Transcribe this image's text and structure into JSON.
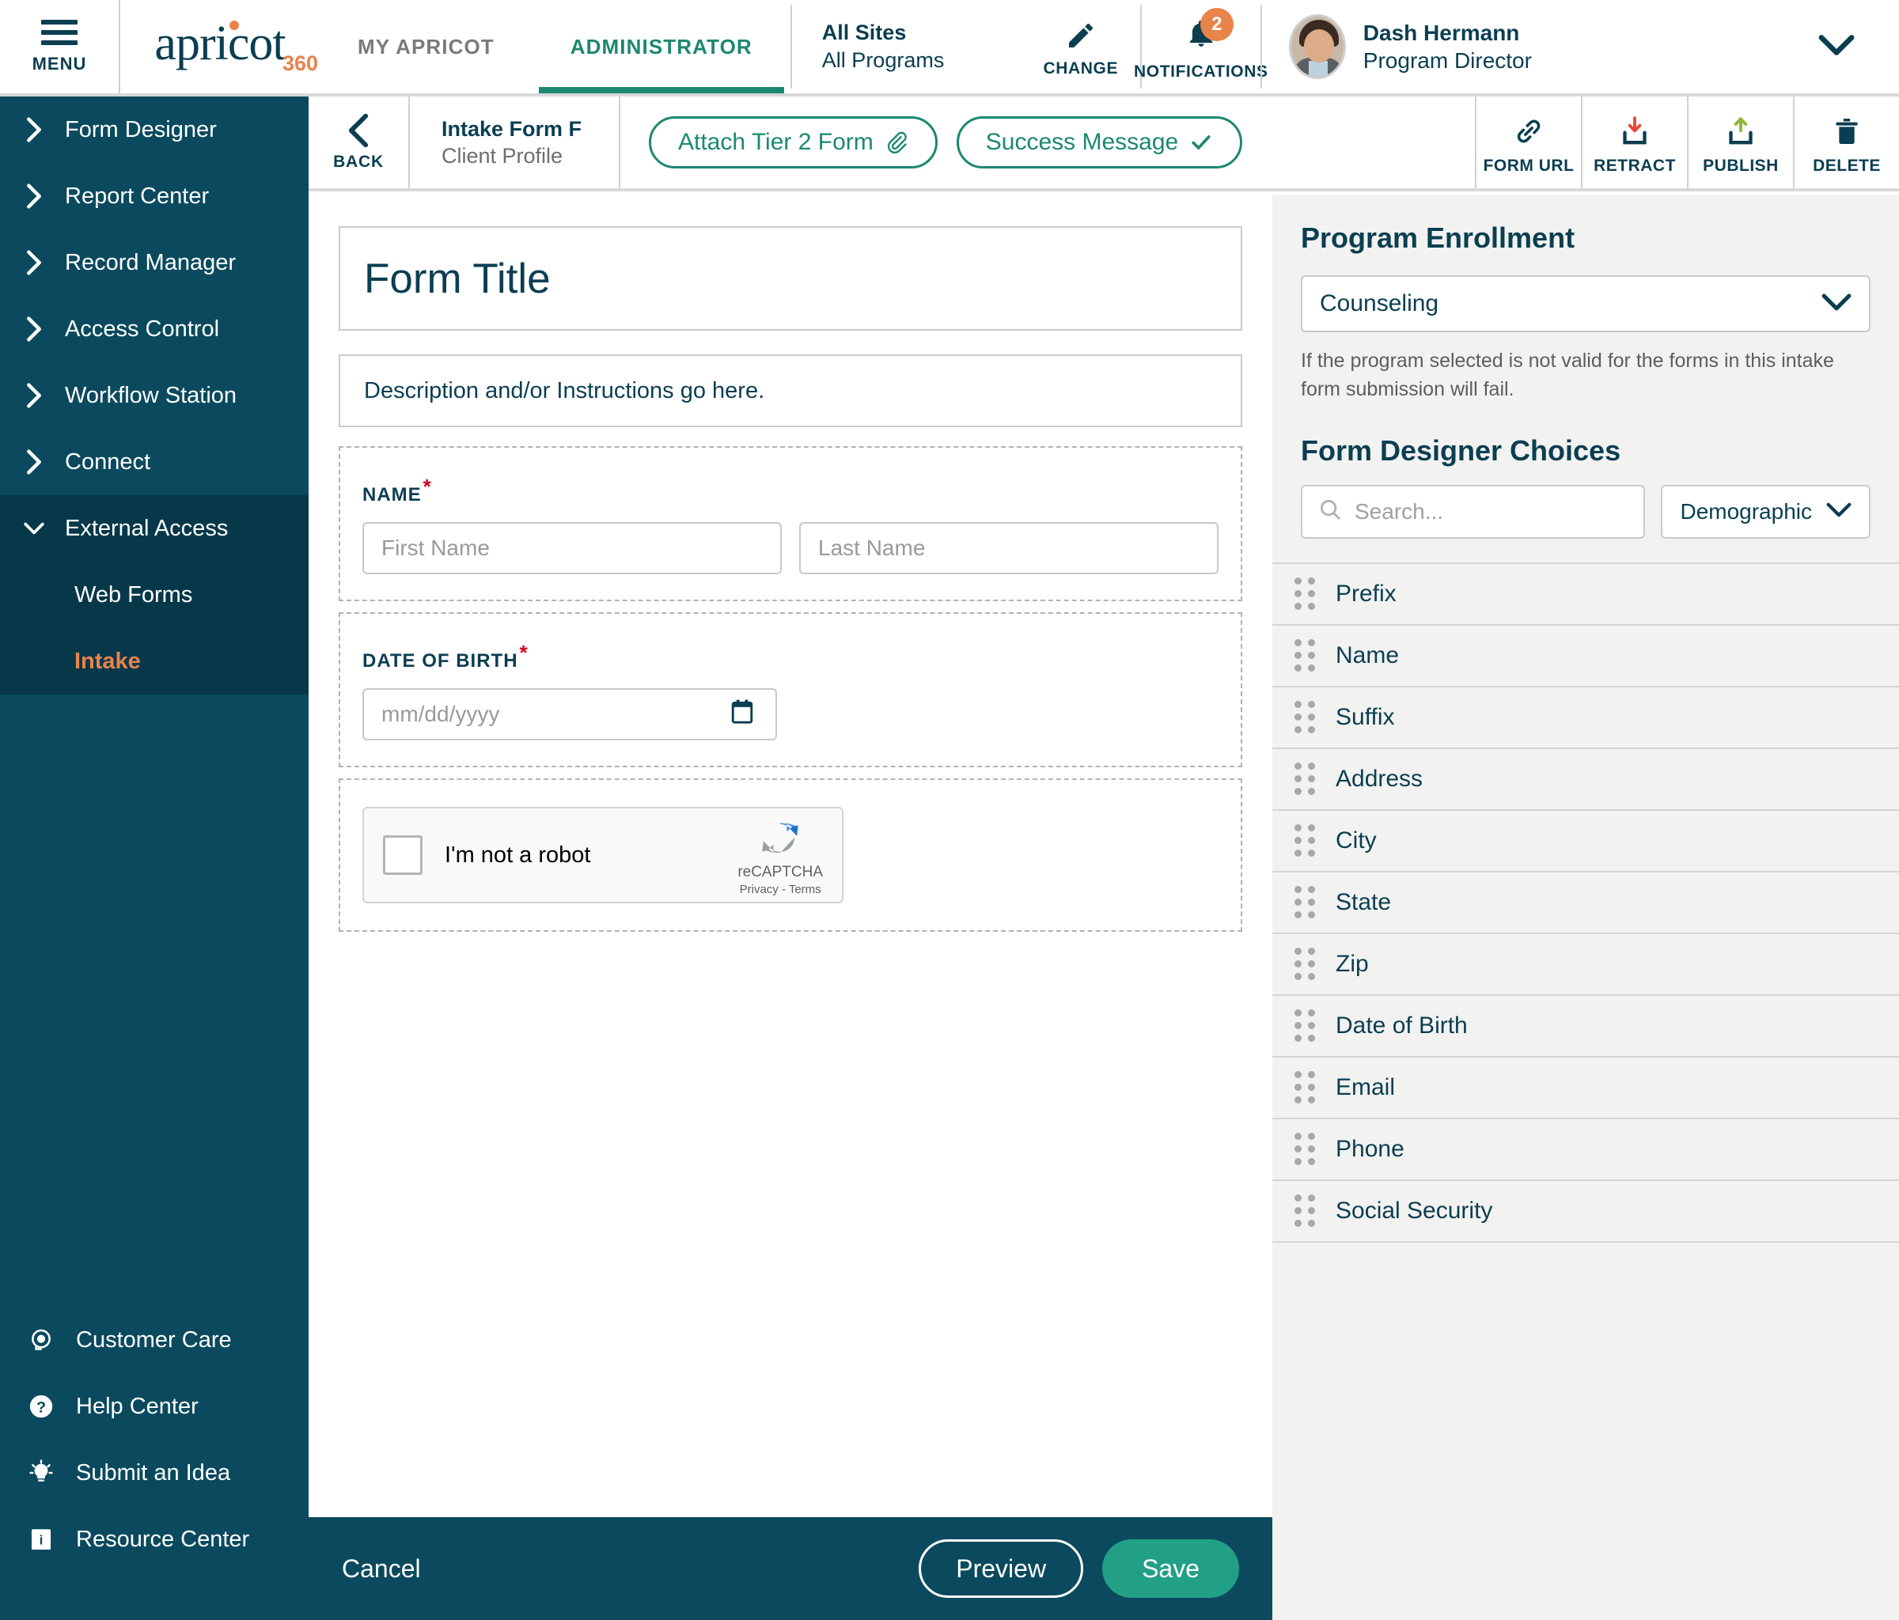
{
  "header": {
    "menu_label": "MENU",
    "logo_text": "apricot",
    "logo_sup": "360",
    "tabs": [
      {
        "label": "MY APRICOT",
        "active": false
      },
      {
        "label": "ADMINISTRATOR",
        "active": true
      }
    ],
    "site_scope": "All Sites",
    "program_scope": "All Programs",
    "change_label": "CHANGE",
    "notifications_label": "NOTIFICATIONS",
    "notifications_count": "2",
    "user_name": "Dash Hermann",
    "user_role": "Program Director"
  },
  "sidebar": {
    "items": [
      {
        "label": "Form Designer"
      },
      {
        "label": "Report Center"
      },
      {
        "label": "Record Manager"
      },
      {
        "label": "Access Control"
      },
      {
        "label": "Workflow Station"
      },
      {
        "label": "Connect"
      },
      {
        "label": "External Access"
      }
    ],
    "subitems": [
      {
        "label": "Web Forms",
        "selected": false
      },
      {
        "label": "Intake",
        "selected": true
      }
    ],
    "footer": [
      {
        "label": "Customer Care",
        "icon": "headset-icon"
      },
      {
        "label": "Help Center",
        "icon": "question-circle-icon"
      },
      {
        "label": "Submit an Idea",
        "icon": "lightbulb-icon"
      },
      {
        "label": "Resource Center",
        "icon": "book-info-icon"
      }
    ]
  },
  "toolbar": {
    "back_label": "BACK",
    "form_name": "Intake Form F",
    "form_subtitle": "Client Profile",
    "attach_label": "Attach Tier 2 Form",
    "success_label": "Success Message",
    "form_url_label": "FORM URL",
    "retract_label": "RETRACT",
    "publish_label": "PUBLISH",
    "delete_label": "DELETE"
  },
  "form": {
    "title": "Form Title",
    "description": "Description and/or Instructions go here.",
    "name_label": "NAME",
    "name_required": "*",
    "first_name_placeholder": "First Name",
    "last_name_placeholder": "Last Name",
    "dob_label": "DATE OF BIRTH",
    "dob_required": "*",
    "dob_placeholder": "mm/dd/yyyy",
    "captcha_text": "I'm not a robot",
    "captcha_brand": "reCAPTCHA",
    "captcha_legal": "Privacy - Terms"
  },
  "panel": {
    "enrollment_heading": "Program Enrollment",
    "enrollment_value": "Counseling",
    "enrollment_note": "If the program selected is not valid for the forms in this intake form submission will fail.",
    "choices_heading": "Form Designer Choices",
    "search_placeholder": "Search...",
    "category_value": "Demographic",
    "choices": [
      {
        "label": "Prefix"
      },
      {
        "label": "Name"
      },
      {
        "label": "Suffix"
      },
      {
        "label": "Address"
      },
      {
        "label": "City"
      },
      {
        "label": "State"
      },
      {
        "label": "Zip"
      },
      {
        "label": "Date of Birth"
      },
      {
        "label": "Email"
      },
      {
        "label": "Phone"
      },
      {
        "label": "Social Security"
      }
    ]
  },
  "footer": {
    "cancel_label": "Cancel",
    "preview_label": "Preview",
    "save_label": "Save"
  },
  "colors": {
    "brand_navy": "#0b3e51",
    "sidebar_navy": "#0b4a5e",
    "accent_teal": "#1c8871",
    "accent_orange": "#e8834a",
    "save_green": "#22a085",
    "required_red": "#d0021b"
  }
}
